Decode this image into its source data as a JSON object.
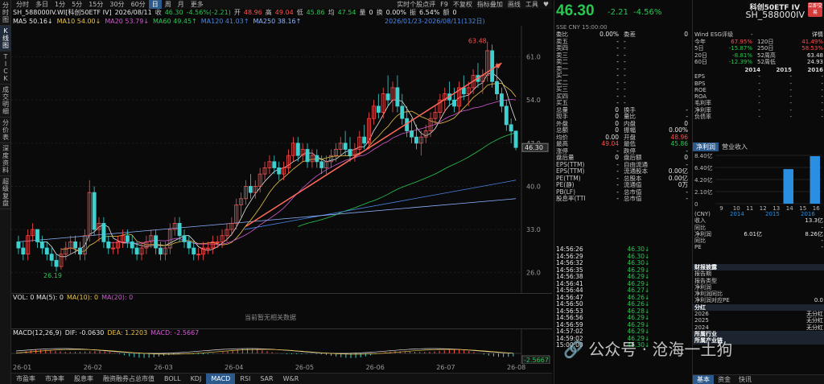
{
  "sidebar": [
    "分时图",
    "K线图",
    "TICK",
    "成交明细",
    "分价表",
    "深度资料",
    "超级复盘"
  ],
  "period_tabs": [
    "分时",
    "多日",
    "1分",
    "5分",
    "15分",
    "30分",
    "60分",
    "日",
    "周",
    "月",
    "更多"
  ],
  "active_period": "日",
  "toolbar_right": [
    "实时个股点评",
    "F9",
    "不复权",
    "指标叠加",
    "画线",
    "工具",
    "♥"
  ],
  "info": {
    "code": "SH_588000IV.WI[科创50ETF IV]",
    "date": "2026/08/11",
    "close_label": "收",
    "close": "46.30",
    "change": "-4.56%(-2.21)",
    "open_label": "开",
    "open": "48.96",
    "high_label": "高",
    "high": "49.04",
    "low_label": "低",
    "low": "45.86",
    "prev_label": "均",
    "prev": "47.54",
    "vol_label": "量",
    "vol": "0",
    "turnover_label": "换",
    "turnover": "0.00%",
    "amp_label": "振",
    "amp": "6.54%",
    "amt_label": "额",
    "amt": "0"
  },
  "ma_line": [
    {
      "label": "MA5",
      "value": "50.16↓",
      "color": "#e6e6e6"
    },
    {
      "label": "MA10",
      "value": "54.00↓",
      "color": "#e8c34a"
    },
    {
      "label": "MA20",
      "value": "53.79↓",
      "color": "#d05ad0"
    },
    {
      "label": "MA60",
      "value": "49.45↑",
      "color": "#28c850"
    },
    {
      "label": "MA120",
      "value": "41.03↑",
      "color": "#4a86e8"
    },
    {
      "label": "MA250",
      "value": "38.16↑",
      "color": "#8fb4ff"
    }
  ],
  "range_label": "2026/01/23-2026/08/11(132日)",
  "chart_data": {
    "type": "candlestick",
    "y_ticks": [
      61.0,
      54.0,
      47.0,
      40.0,
      33.0,
      26.0
    ],
    "high_mark": "63.48",
    "low_mark": "26.19",
    "last_price": "46.30",
    "x_labels": [
      "26-01",
      "26-02",
      "26-03",
      "26-04",
      "26-05",
      "26-06",
      "26-07",
      "26-08"
    ],
    "candles": [
      [
        31,
        32,
        29,
        30
      ],
      [
        30,
        31,
        28,
        29
      ],
      [
        29,
        33,
        28,
        32
      ],
      [
        32,
        34,
        31,
        33
      ],
      [
        33,
        33,
        30,
        31
      ],
      [
        31,
        32,
        29,
        30
      ],
      [
        30,
        31,
        28,
        29
      ],
      [
        29,
        30,
        27,
        28
      ],
      [
        28,
        29,
        26.19,
        27
      ],
      [
        27,
        30,
        26.5,
        29
      ],
      [
        29,
        31,
        28,
        30
      ],
      [
        30,
        32,
        29,
        31
      ],
      [
        31,
        32,
        29,
        30
      ],
      [
        30,
        31,
        28,
        29
      ],
      [
        29,
        33,
        28,
        32
      ],
      [
        32,
        41,
        31,
        39
      ],
      [
        39,
        40,
        32,
        33
      ],
      [
        33,
        35,
        31,
        34
      ],
      [
        34,
        35,
        30,
        31
      ],
      [
        31,
        32,
        29,
        30
      ],
      [
        30,
        31,
        29,
        30
      ],
      [
        30,
        32,
        29,
        31
      ],
      [
        31,
        33,
        30,
        32
      ],
      [
        32,
        33,
        30,
        31
      ],
      [
        31,
        32,
        29,
        30
      ],
      [
        30,
        31,
        28,
        29
      ],
      [
        29,
        31,
        28,
        30
      ],
      [
        30,
        32,
        29,
        31
      ],
      [
        31,
        33,
        30,
        32
      ],
      [
        32,
        33,
        29,
        30
      ],
      [
        30,
        31,
        28,
        29
      ],
      [
        29,
        31,
        28,
        30
      ],
      [
        30,
        34,
        29,
        33
      ],
      [
        33,
        35,
        32,
        34
      ],
      [
        34,
        35,
        31,
        32
      ],
      [
        32,
        33,
        30,
        31
      ],
      [
        31,
        32,
        29,
        30
      ],
      [
        30,
        31,
        28,
        29
      ],
      [
        29,
        30,
        28,
        29
      ],
      [
        29,
        31,
        28,
        30
      ],
      [
        30,
        31,
        29,
        30
      ],
      [
        30,
        32,
        29,
        31
      ],
      [
        31,
        32,
        30,
        31
      ],
      [
        31,
        33,
        30,
        32
      ],
      [
        32,
        34,
        31,
        33
      ],
      [
        33,
        35,
        32,
        34
      ],
      [
        34,
        38,
        33,
        37
      ],
      [
        37,
        39,
        35,
        38
      ],
      [
        38,
        41,
        37,
        40
      ],
      [
        40,
        42,
        38,
        39
      ],
      [
        39,
        41,
        38,
        40
      ],
      [
        40,
        43,
        39,
        42
      ],
      [
        42,
        44,
        41,
        43
      ],
      [
        43,
        45,
        42,
        44
      ],
      [
        44,
        45,
        42,
        43
      ],
      [
        43,
        44,
        41,
        42
      ],
      [
        42,
        44,
        41,
        43
      ],
      [
        43,
        46,
        42,
        45
      ],
      [
        45,
        48,
        44,
        47
      ],
      [
        47,
        48,
        44,
        45
      ],
      [
        45,
        47,
        44,
        46
      ],
      [
        46,
        47,
        43,
        44
      ],
      [
        44,
        46,
        43,
        45
      ],
      [
        45,
        46,
        43,
        44
      ],
      [
        44,
        45,
        42,
        43
      ],
      [
        43,
        45,
        42,
        44
      ],
      [
        44,
        46,
        43,
        45
      ],
      [
        45,
        47,
        44,
        46
      ],
      [
        46,
        48,
        45,
        47
      ],
      [
        47,
        49,
        45,
        46
      ],
      [
        46,
        48,
        44,
        45
      ],
      [
        45,
        47,
        44,
        46
      ],
      [
        46,
        49,
        45,
        48
      ],
      [
        48,
        50,
        46,
        47
      ],
      [
        47,
        52,
        46,
        51
      ],
      [
        51,
        54,
        50,
        53
      ],
      [
        53,
        55,
        51,
        52
      ],
      [
        52,
        56,
        51,
        55
      ],
      [
        55,
        58,
        53,
        54
      ],
      [
        54,
        57,
        52,
        56
      ],
      [
        56,
        58,
        52,
        53
      ],
      [
        53,
        55,
        50,
        51
      ],
      [
        51,
        53,
        48,
        49
      ],
      [
        49,
        51,
        47,
        48
      ],
      [
        48,
        50,
        46,
        47
      ],
      [
        47,
        49,
        45,
        48
      ],
      [
        48,
        50,
        47,
        49
      ],
      [
        49,
        52,
        48,
        51
      ],
      [
        51,
        53,
        50,
        52
      ],
      [
        52,
        55,
        51,
        54
      ],
      [
        54,
        56,
        52,
        55
      ],
      [
        55,
        57,
        53,
        54
      ],
      [
        54,
        56,
        52,
        53
      ],
      [
        53,
        57,
        52,
        56
      ],
      [
        56,
        58,
        54,
        55
      ],
      [
        55,
        57,
        53,
        56
      ],
      [
        56,
        59,
        55,
        58
      ],
      [
        58,
        60,
        56,
        57
      ],
      [
        57,
        59,
        55,
        58
      ],
      [
        58,
        63.48,
        57,
        62
      ],
      [
        62,
        63,
        56,
        57
      ],
      [
        57,
        60,
        54,
        55
      ],
      [
        55,
        56,
        52,
        53
      ],
      [
        53,
        54,
        49,
        50
      ],
      [
        50,
        51,
        47,
        48.96
      ],
      [
        48.96,
        49.04,
        45.86,
        46.3
      ]
    ]
  },
  "volume": {
    "label": "VOL: 0 MA(5): 0",
    "ma10": "MA(10): 0",
    "ma20": "MA(20): 0",
    "no_data": "当前暂无相关数据"
  },
  "macd": {
    "label": "MACD(12,26,9)",
    "dif": "DIF: -0.0630",
    "dea": "DEA: 1.2203",
    "macd": "MACD: -2.5667",
    "last": "-2.5667"
  },
  "bottom_tabs": [
    "市盈率",
    "市净率",
    "股息率",
    "融资融券占总市值",
    "BOLL",
    "KDJ",
    "MACD",
    "RSI",
    "SAR",
    "W&R"
  ],
  "active_bottom_tab": "MACD",
  "quote": {
    "price": "46.30",
    "change_abs": "-2.21",
    "change_pct": "-4.56%",
    "exchange_line": "SSE  CNY  15:00:00",
    "rows1": [
      [
        "委比",
        "0.00%",
        "委差",
        "0"
      ],
      [
        "卖五",
        "-",
        "-",
        ""
      ],
      [
        "卖四",
        "-",
        "-",
        ""
      ],
      [
        "卖三",
        "-",
        "-",
        ""
      ],
      [
        "卖二",
        "-",
        "-",
        ""
      ],
      [
        "卖一",
        "-",
        "-",
        ""
      ],
      [
        "买一",
        "-",
        "-",
        ""
      ],
      [
        "买二",
        "-",
        "-",
        ""
      ],
      [
        "买三",
        "-",
        "-",
        ""
      ],
      [
        "买四",
        "-",
        "-",
        ""
      ],
      [
        "买五",
        "-",
        "-",
        ""
      ],
      [
        "总量",
        "0",
        "换手",
        "-"
      ],
      [
        "现手",
        "0",
        "量比",
        "-"
      ],
      [
        "外盘",
        "0",
        "内盘",
        "0"
      ],
      [
        "总额",
        "0",
        "振幅",
        "0.00%"
      ],
      [
        "均价",
        "0.00",
        "开盘",
        "48.96"
      ],
      [
        "最高",
        "49.04",
        "最低",
        "45.86"
      ],
      [
        "涨停",
        "-",
        "跌停",
        "-"
      ],
      [
        "盘后量",
        "0",
        "盘后额",
        "0"
      ],
      [
        "EPS(TTM)",
        "-",
        "自由流通",
        "-"
      ],
      [
        "EPS(TTM)",
        "-",
        "流通股本",
        "0.00亿"
      ],
      [
        "PE(TTM)",
        "-",
        "总股本",
        "0.00亿"
      ],
      [
        "PE(静)",
        "-",
        "流通值",
        "0万"
      ],
      [
        "PB(LF)",
        "-",
        "总市值",
        "-"
      ],
      [
        "股息率(TTM)",
        "-",
        "总市值",
        "-"
      ]
    ],
    "ticks": [
      [
        "14:56:26",
        "46.30"
      ],
      [
        "14:56:29",
        "46.30"
      ],
      [
        "14:56:32",
        "46.30"
      ],
      [
        "14:56:35",
        "46.29"
      ],
      [
        "14:56:38",
        "46.29"
      ],
      [
        "14:56:41",
        "46.29"
      ],
      [
        "14:56:44",
        "46.27"
      ],
      [
        "14:56:47",
        "46.26"
      ],
      [
        "14:56:50",
        "46.26"
      ],
      [
        "14:56:53",
        "46.28"
      ],
      [
        "14:56:56",
        "46.29"
      ],
      [
        "14:56:59",
        "46.29"
      ],
      [
        "14:57:02",
        "46.29"
      ],
      [
        "14:59:02",
        "46.29"
      ],
      [
        "15:00:00",
        "46.30"
      ]
    ]
  },
  "fund": {
    "title": "科创50ETF IV",
    "code": "SH_588000IV",
    "badge": "立即交易",
    "esg_label": "Wind ESG评级",
    "esg_value": "-",
    "detail": "详情",
    "perf": [
      [
        "今年",
        "67.95%",
        "120日",
        "41.49%"
      ],
      [
        "5日",
        "-15.87%",
        "250日",
        "58.53%"
      ],
      [
        "20日",
        "-8.81%",
        "52周高",
        "63.48"
      ],
      [
        "60日",
        "-12.39%",
        "52周低",
        "24.93"
      ]
    ],
    "years": [
      "2014",
      "2015",
      "2016"
    ],
    "fin_rows": [
      "EPS",
      "BPS",
      "ROE",
      "ROA",
      "毛利率",
      "净利率",
      "负债率"
    ],
    "profit_tab": "净利润",
    "revenue_tab": "营业收入",
    "bar_y": [
      "8.40亿",
      "6.40亿",
      "4.20亿",
      "2.10亿",
      "0"
    ],
    "bar_x": [
      "9",
      "10",
      "11",
      "12",
      "13",
      "14",
      "15",
      "16"
    ],
    "bar_values": [
      0,
      0,
      0,
      0,
      0,
      6.01,
      0,
      8.26
    ],
    "bar_years": [
      "2014",
      "2015",
      "2016"
    ],
    "unit": "(CNY)",
    "income_rows": [
      [
        "收入",
        "",
        "13.3亿"
      ],
      [
        "同比",
        "",
        "-"
      ],
      [
        "净利润",
        "6.01亿",
        "8.26亿"
      ],
      [
        "同比",
        "",
        "-"
      ],
      [
        "PE",
        "",
        "-"
      ]
    ],
    "report_head": "财报披露",
    "report_rows": [
      "报告期",
      "报告类型",
      "净利润",
      "净利润同比",
      "净利润对应PE"
    ],
    "report_last": "0.0",
    "div_head": "分红",
    "div_rows": [
      [
        "2026",
        "无分红"
      ],
      [
        "2025",
        "无分红"
      ],
      [
        "2024",
        "无分红"
      ]
    ],
    "industry_head": "所属行业",
    "chain_head": "所属产业链",
    "tabs": [
      "基本",
      "资金",
      "快讯"
    ],
    "active_tab": "基本"
  },
  "watermark": "🔗 公众号 · 沧海一土狗"
}
